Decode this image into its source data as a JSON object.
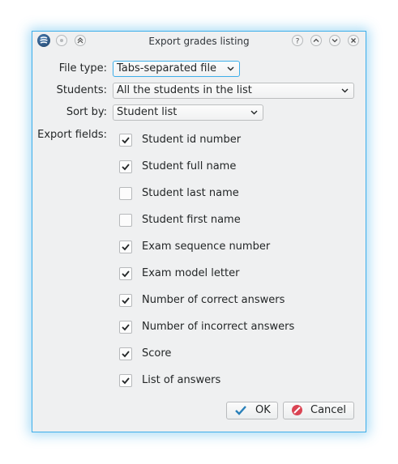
{
  "window": {
    "title": "Export grades listing"
  },
  "form": {
    "file_type": {
      "label": "File type:",
      "value": "Tabs-separated file"
    },
    "students": {
      "label": "Students:",
      "value": "All the students in the list"
    },
    "sort_by": {
      "label": "Sort by:",
      "value": "Student list"
    },
    "export_fields_label": "Export fields:",
    "fields": [
      {
        "label": "Student id number",
        "checked": true
      },
      {
        "label": "Student full name",
        "checked": true
      },
      {
        "label": "Student last name",
        "checked": false
      },
      {
        "label": "Student first name",
        "checked": false
      },
      {
        "label": "Exam sequence number",
        "checked": true
      },
      {
        "label": "Exam model letter",
        "checked": true
      },
      {
        "label": "Number of correct answers",
        "checked": true
      },
      {
        "label": "Number of incorrect answers",
        "checked": true
      },
      {
        "label": "Score",
        "checked": true
      },
      {
        "label": "List of answers",
        "checked": true
      }
    ]
  },
  "buttons": {
    "ok": "OK",
    "cancel": "Cancel"
  },
  "colors": {
    "accent": "#3daee9",
    "cancel_icon": "#da4453",
    "ok_icon": "#2980b9"
  }
}
